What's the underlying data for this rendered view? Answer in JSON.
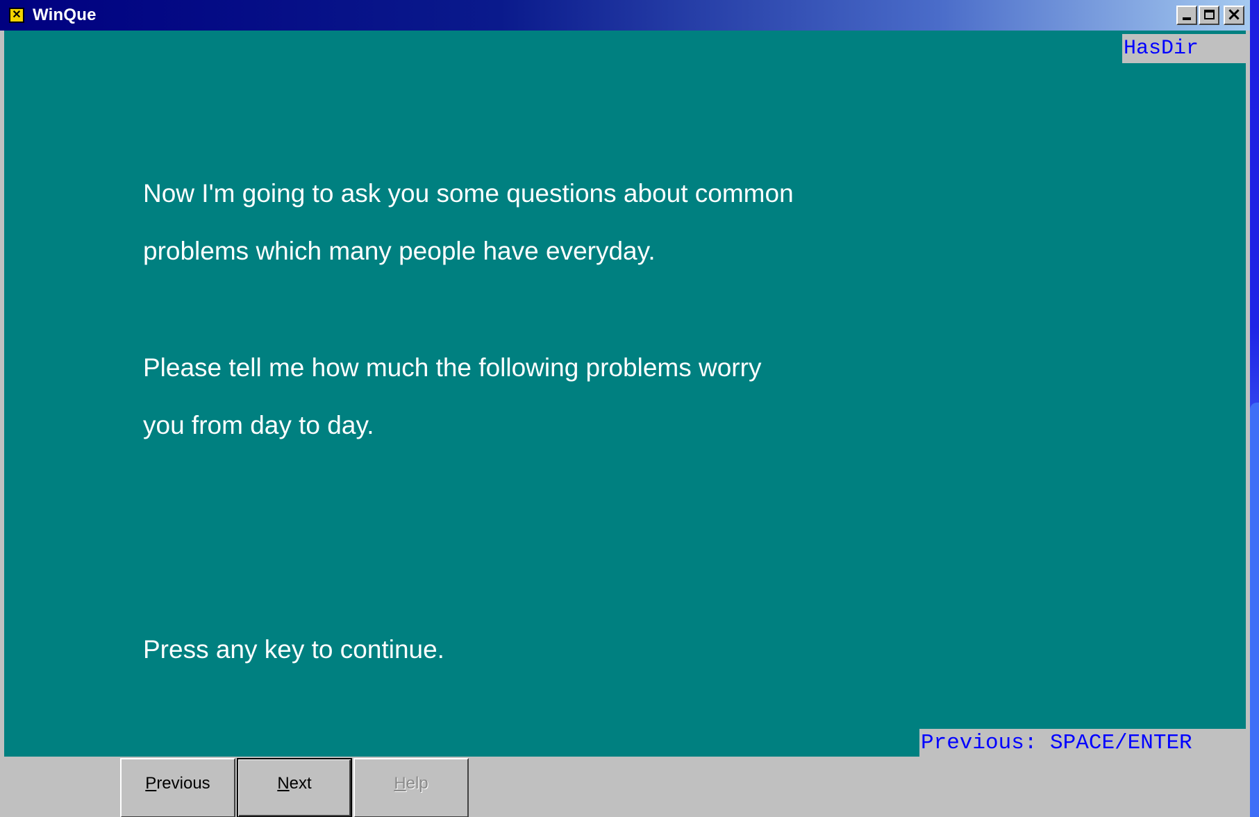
{
  "window": {
    "title": "WinQue",
    "icon": "application-x-icon",
    "controls": {
      "minimize": "minimize-icon",
      "maximize": "maximize-icon",
      "close": "close-icon"
    }
  },
  "status": {
    "top": "HasDir",
    "bottom": "Previous: SPACE/ENTER"
  },
  "prompt": {
    "lines": [
      "Now I'm going to ask you some questions about common",
      "problems which many people have everyday.",
      "Please tell me how much the following problems worry",
      "you from day to day.",
      "Press any key to continue."
    ]
  },
  "buttons": {
    "previous": {
      "accel": "P",
      "rest": "revious"
    },
    "next": {
      "accel": "N",
      "rest": "ext"
    },
    "help": {
      "accel": "H",
      "rest": "elp",
      "enabled": false
    }
  },
  "colors": {
    "title_bar_start": "#000080",
    "title_bar_end": "#a6caf0",
    "content_background": "#008080",
    "content_text": "#ffffff",
    "status_text": "#0000ff",
    "chrome": "#c0c0c0",
    "desktop": "#1414d8"
  }
}
